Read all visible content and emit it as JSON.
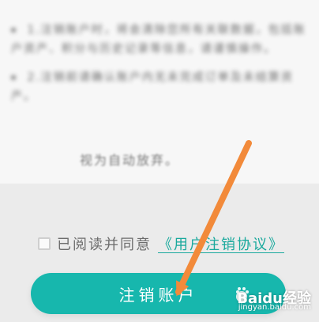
{
  "agreement": {
    "prefix": "已阅读并同意",
    "link": "《用户注销协议》"
  },
  "actions": {
    "cancel_account": "注销账户"
  },
  "content": {
    "blurred_paragraphs": [
      "1.注销账户时，将会清除您所有关联数据，包括账户资产、积分与历史记录等信息，请谨慎操作。",
      "2.注销前请确认账户内无未完成订单及未结算资产。"
    ],
    "auto_abandon": "视为自动放弃。"
  },
  "watermark": {
    "main": "Baidu经验",
    "sub": "jingyan.baidu.com"
  },
  "colors": {
    "accent": "#17b7ad",
    "link": "#1aa99d",
    "arrow": "#f28a3a"
  }
}
